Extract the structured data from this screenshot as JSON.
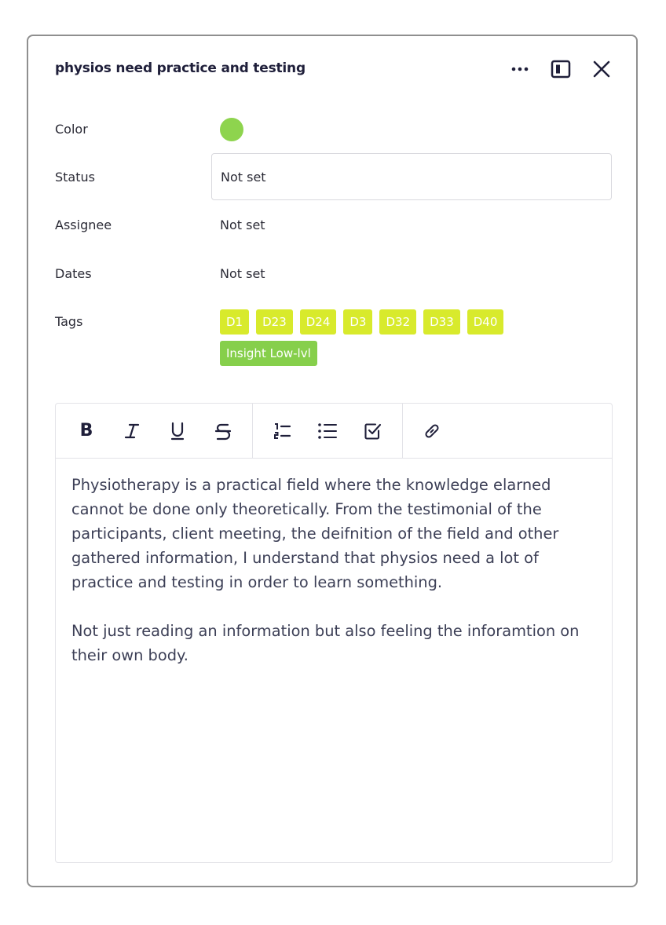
{
  "panel": {
    "title": "physios need practice and testing",
    "actions": {
      "more_icon": "more-horizontal-icon",
      "side_panel_icon": "panel-toggle-icon",
      "close_icon": "close-icon"
    }
  },
  "fields": {
    "color": {
      "label": "Color",
      "value": "#8ed44e"
    },
    "status": {
      "label": "Status",
      "value": "Not set"
    },
    "assignee": {
      "label": "Assignee",
      "value": "Not set"
    },
    "dates": {
      "label": "Dates",
      "value": "Not set"
    },
    "tags": {
      "label": "Tags",
      "items": [
        {
          "label": "D1",
          "color": "#d8ea2c"
        },
        {
          "label": "D23",
          "color": "#d8ea2c"
        },
        {
          "label": "D24",
          "color": "#d8ea2c"
        },
        {
          "label": "D3",
          "color": "#d8ea2c"
        },
        {
          "label": "D32",
          "color": "#d8ea2c"
        },
        {
          "label": "D33",
          "color": "#d8ea2c"
        },
        {
          "label": "D40",
          "color": "#d8ea2c"
        },
        {
          "label": "Insight Low-lvl",
          "color": "#86cf4b"
        }
      ]
    }
  },
  "editor": {
    "toolbar": {
      "bold": "B",
      "icons": [
        "italic-icon",
        "underline-icon",
        "strikethrough-icon",
        "ordered-list-icon",
        "bullet-list-icon",
        "checklist-icon",
        "link-icon"
      ]
    },
    "paragraphs": [
      "Physiotherapy is a practical field where the knowledge elarned cannot be done only theoretically. From the testimonial of the participants, client meeting, the deifnition of the field and other gathered information, I understand that physios need a lot of practice and testing in order to learn something.",
      "Not just reading an information but also feeling the inforamtion on their own body."
    ]
  }
}
